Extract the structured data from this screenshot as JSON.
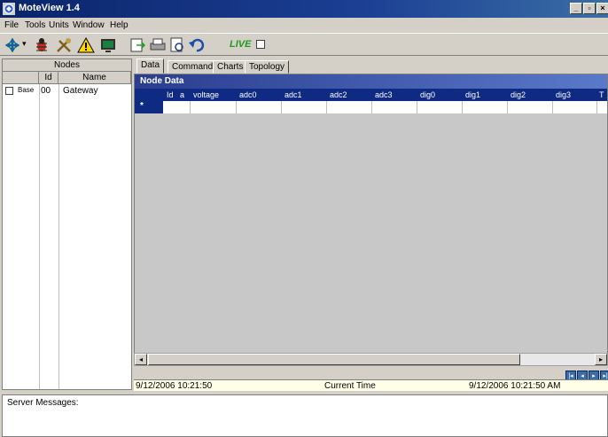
{
  "window": {
    "title": "MoteView 1.4",
    "controls": [
      "_",
      "▫",
      "×"
    ]
  },
  "menu": [
    "File",
    "Tools",
    "Units",
    "Window",
    "Help"
  ],
  "toolbar": {
    "live_label": "LIVE",
    "live_checked": false
  },
  "nodes_panel": {
    "title": "Nodes",
    "columns": [
      "Id",
      "Name"
    ],
    "rows": [
      {
        "icon": "Base",
        "id": "00",
        "name": "Gateway"
      }
    ]
  },
  "tabs": [
    "Data",
    "Command",
    "Charts",
    "Topology"
  ],
  "grid": {
    "caption": "Node Data",
    "columns": [
      "Id",
      "a",
      "voltage",
      "adc0",
      "adc1",
      "adc2",
      "adc3",
      "dig0",
      "dig1",
      "dig2",
      "dig3",
      "T"
    ],
    "new_row_marker": "*"
  },
  "status": {
    "left_time": "9/12/2006 10:21:50",
    "center_label": "Current Time",
    "right_time": "9/12/2006 10:21:50 AM"
  },
  "server_messages": {
    "label": "Server Messages:"
  }
}
